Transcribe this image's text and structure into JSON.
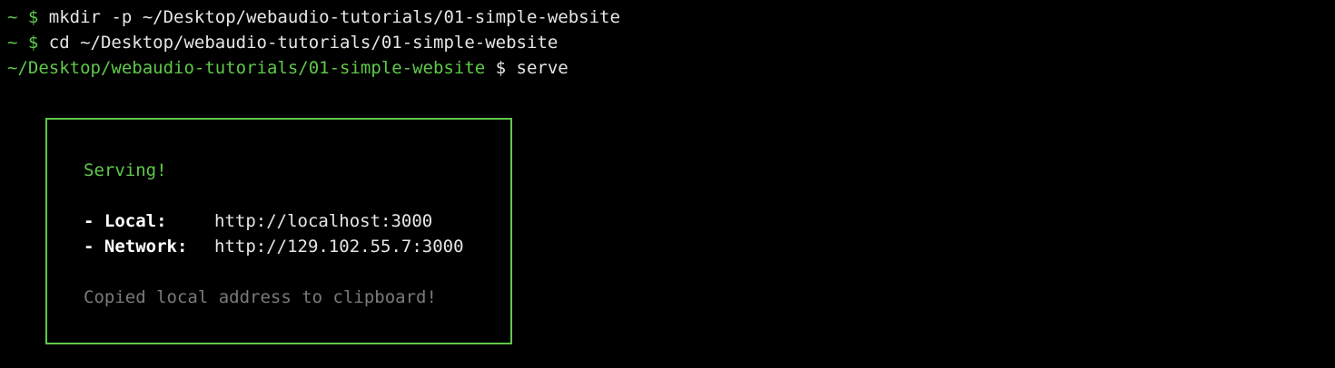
{
  "terminal": {
    "history": [
      {
        "prompt": "~ $ ",
        "command": "mkdir -p ~/Desktop/webaudio-tutorials/01-simple-website"
      },
      {
        "prompt": "~ $ ",
        "command": "cd ~/Desktop/webaudio-tutorials/01-simple-website"
      }
    ],
    "current": {
      "cwd": "~/Desktop/webaudio-tutorials/01-simple-website",
      "prompt_symbol": " $ ",
      "command": "serve"
    }
  },
  "serve_box": {
    "status": "Serving!",
    "local": {
      "label": "- Local:",
      "url": "http://localhost:3000"
    },
    "network": {
      "label": "- Network:",
      "url": "http://129.102.55.7:3000"
    },
    "note": "Copied local address to clipboard!"
  },
  "colors": {
    "background": "#000000",
    "accent_green": "#5fc94a",
    "text": "#e6e6e6",
    "dim_text": "#7a7a7a"
  }
}
